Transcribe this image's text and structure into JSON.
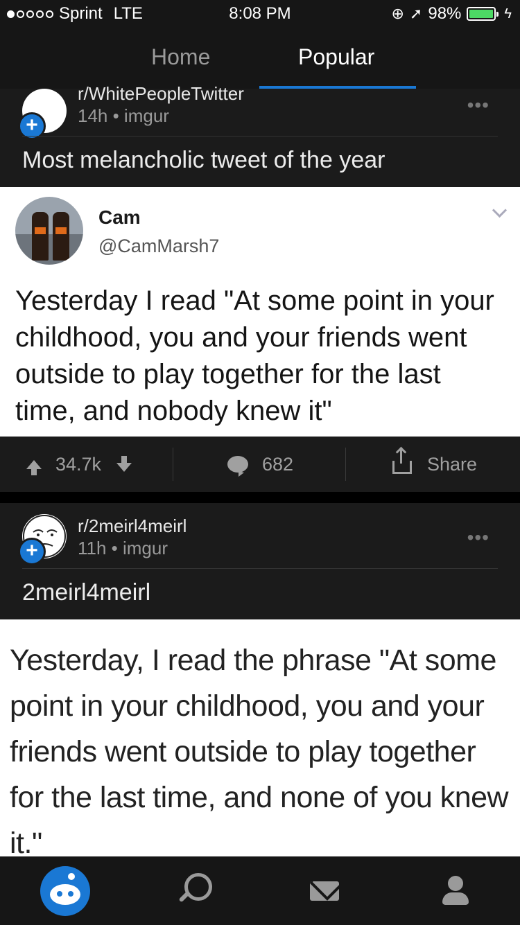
{
  "status_bar": {
    "carrier": "Sprint",
    "network": "LTE",
    "time": "8:08 PM",
    "battery": "98%",
    "battery_level": 0.98
  },
  "tabs": [
    {
      "label": "Home",
      "active": false
    },
    {
      "label": "Popular",
      "active": true
    }
  ],
  "posts": [
    {
      "subreddit": "r/WhitePeopleTwitter",
      "meta": "14h • imgur",
      "title": "Most melancholic tweet of the year",
      "tweet": {
        "name": "Cam",
        "handle": "@CamMarsh7",
        "text": "Yesterday I read \"At some point in your childhood, you and your friends went outside to play together for the last time, and nobody knew it\""
      },
      "actions": {
        "score": "34.7k",
        "comments": "682",
        "share_label": "Share"
      }
    },
    {
      "subreddit": "r/2meirl4meirl",
      "meta": "11h • imgur",
      "title": "2meirl4meirl",
      "image_text": "Yesterday, I read the phrase \"At some point in your childhood, you and your friends went outside to play together for the last time, and none of you knew it.\""
    }
  ],
  "colors": {
    "accent": "#1a78d4",
    "battery": "#4cd964",
    "background": "#000000",
    "card": "#1b1b1b"
  },
  "bottom_nav": [
    "home-snoo-icon",
    "search-icon",
    "mail-icon",
    "profile-icon"
  ]
}
